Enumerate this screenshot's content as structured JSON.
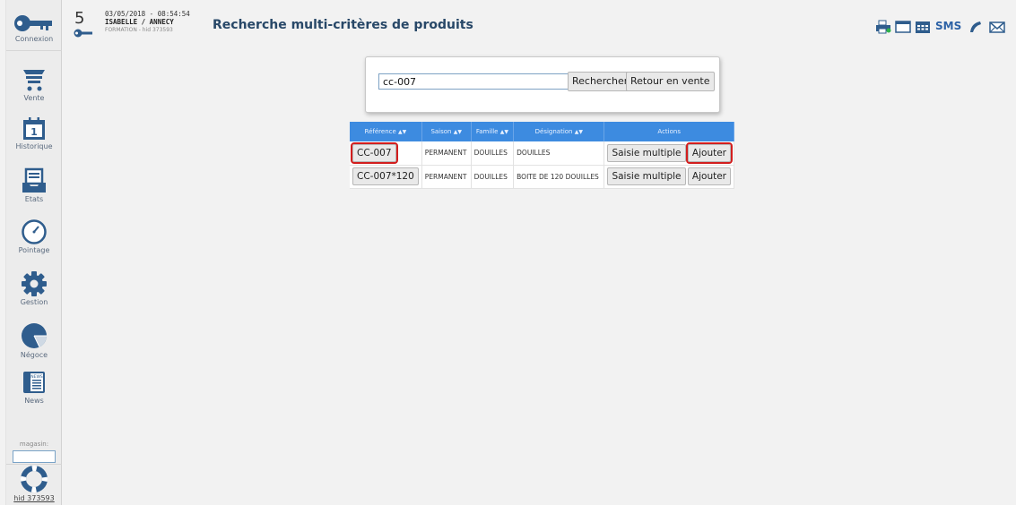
{
  "sidebar": {
    "items": [
      {
        "label": "Connexion"
      },
      {
        "label": "Vente"
      },
      {
        "label": "Historique"
      },
      {
        "label": "Etats"
      },
      {
        "label": "Pointage"
      },
      {
        "label": "Gestion"
      },
      {
        "label": "Négoce"
      },
      {
        "label": "News"
      }
    ],
    "calendar_day": "1",
    "news_badge": "NEWS",
    "magasin_label": "magasin:",
    "magasin_value": "",
    "hid_label": "hid 373593"
  },
  "header": {
    "count": "5",
    "datetime": "03/05/2018 - 08:54:54",
    "user": "ISABELLE / ANNECY",
    "sub": "FORMATION - hid 373593",
    "title": "Recherche multi-critères de produits"
  },
  "toolbar": {
    "icons": [
      "printer-icon",
      "window-icon",
      "calendar-icon",
      "phone-icon",
      "mail-icon"
    ],
    "sms_label": "SMS"
  },
  "search": {
    "value": "cc-007",
    "search_button": "Rechercher",
    "back_button": "Retour en vente"
  },
  "table": {
    "headers": {
      "reference": "Référence",
      "saison": "Saison",
      "famille": "Famille",
      "designation": "Désignation",
      "actions": "Actions"
    },
    "sort_arrows": "▲▼",
    "rows": [
      {
        "reference": "CC-007",
        "saison": "PERMANENT",
        "famille": "DOUILLES",
        "designation": "DOUILLES",
        "action1": "Saisie multiple",
        "action2": "Ajouter"
      },
      {
        "reference": "CC-007*120",
        "saison": "PERMANENT",
        "famille": "DOUILLES",
        "designation": "BOITE DE 120 DOUILLES",
        "action1": "Saisie multiple",
        "action2": "Ajouter"
      }
    ]
  },
  "colors": {
    "accent": "#3d8be0",
    "title": "#284868",
    "highlight": "#d21e1e"
  }
}
